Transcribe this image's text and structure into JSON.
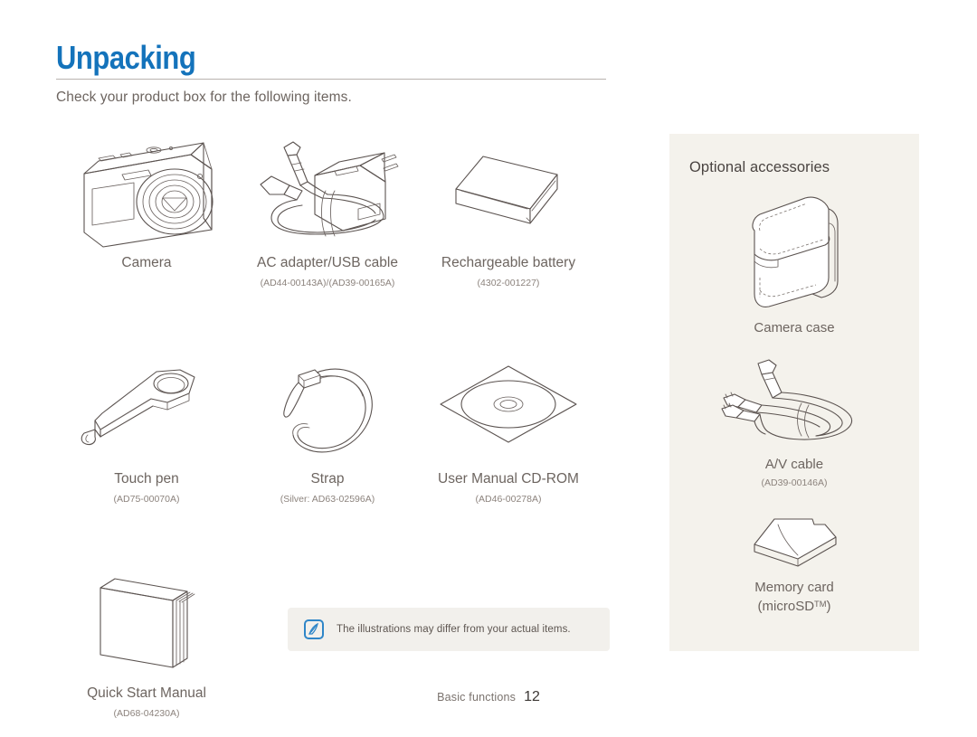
{
  "header": {
    "title": "Unpacking",
    "subtitle": "Check your product box for the following items.",
    "accent_color": "#1473bb"
  },
  "items": [
    {
      "label": "Camera",
      "code": "",
      "icon": "camera-illustration"
    },
    {
      "label": "AC adapter/USB cable",
      "code": "(AD44-00143A)/(AD39-00165A)",
      "icon": "ac-adapter-illustration"
    },
    {
      "label": "Rechargeable battery",
      "code": "(4302-001227)",
      "icon": "battery-illustration"
    },
    {
      "label": "Touch pen",
      "code": "(AD75-00070A)",
      "icon": "touch-pen-illustration"
    },
    {
      "label": "Strap",
      "code": "(Silver: AD63-02596A)",
      "icon": "strap-illustration"
    },
    {
      "label": "User Manual CD-ROM",
      "code": "(AD46-00278A)",
      "icon": "cd-rom-illustration"
    },
    {
      "label": "Quick Start Manual",
      "code": "(AD68-04230A)",
      "icon": "manual-illustration"
    }
  ],
  "note": {
    "icon": "note-pen-icon",
    "text": "The illustrations may differ from your actual items.",
    "background_color": "#f2f0ec",
    "icon_color": "#2f86c8"
  },
  "sidebar": {
    "title": "Optional accessories",
    "background_color": "#f4f2ec",
    "accessories": [
      {
        "label": "Camera case",
        "code": "",
        "icon": "camera-case-illustration"
      },
      {
        "label": "A/V cable",
        "code": "(AD39-00146A)",
        "icon": "av-cable-illustration"
      },
      {
        "label": "Memory card",
        "label_line2": "(microSD",
        "label_trademark": "TM",
        "label_line2_end": ")",
        "code": "",
        "icon": "microsd-card-illustration"
      }
    ]
  },
  "footer": {
    "section": "Basic functions",
    "page_number": "12"
  }
}
